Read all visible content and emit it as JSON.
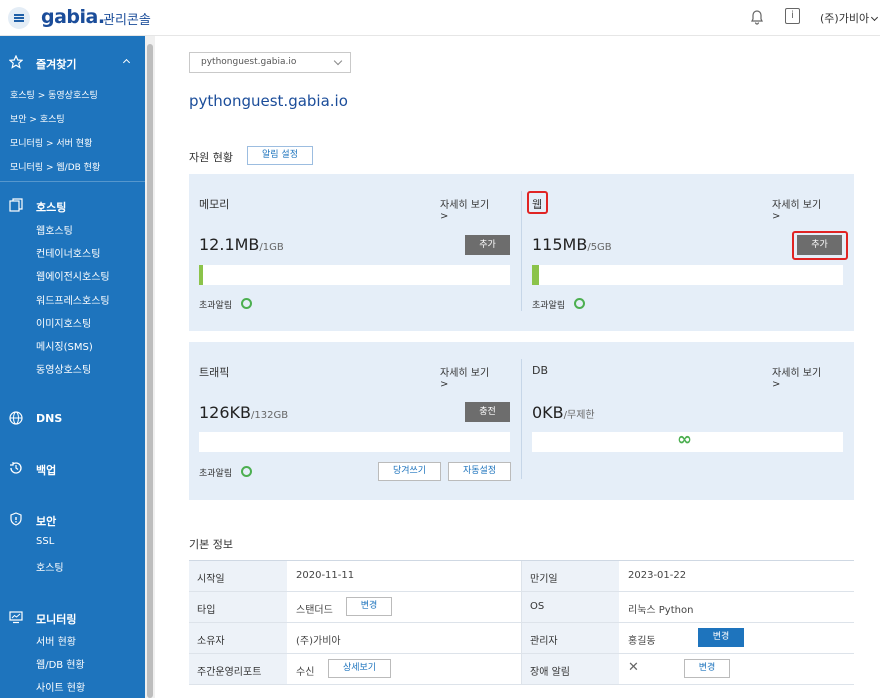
{
  "header": {
    "logo": "gabia.",
    "console_label": "관리콘솔",
    "user_menu": "(주)가비아",
    "info_glyph": "i",
    "icons": [
      "menu-icon",
      "bell-icon",
      "info-icon",
      "chevron-down-icon"
    ]
  },
  "sidebar": {
    "favorites": {
      "title": "즐겨찾기",
      "items": [
        "호스팅 > 동영상호스팅",
        "보안 > 호스팅",
        "모니터링 > 서버 현황",
        "모니터링 > 웹/DB 현황"
      ]
    },
    "hosting": {
      "title": "호스팅",
      "items": [
        "웹호스팅",
        "컨테이너호스팅",
        "웹에이전시호스팅",
        "워드프레스호스팅",
        "이미지호스팅",
        "메시징(SMS)",
        "동영상호스팅"
      ]
    },
    "dns": {
      "title": "DNS"
    },
    "backup": {
      "title": "백업"
    },
    "security": {
      "title": "보안",
      "items": [
        "SSL",
        "호스팅"
      ]
    },
    "monitoring": {
      "title": "모니터링",
      "items": [
        "서버 현황",
        "웹/DB 현황",
        "사이트 현황"
      ]
    },
    "accent_color": "#1e74bd"
  },
  "main": {
    "domain_select": "pythonguest.gabia.io",
    "domain_title": "pythonguest.gabia.io",
    "resources": {
      "label": "자원 현황",
      "alert_settings_button": "알림 설정",
      "detail_link": "자세히 보기 >",
      "memory": {
        "title": "메모리",
        "value": "12.1MB",
        "unit": "/1GB",
        "usage_fraction": 0.012,
        "button": "추가",
        "alert_label": "초과알림"
      },
      "web": {
        "title": "웹",
        "value": "115MB",
        "unit": "/5GB",
        "usage_fraction": 0.023,
        "button": "추가",
        "alert_label": "초과알림"
      },
      "traffic": {
        "title": "트래픽",
        "value": "126KB",
        "unit": "/132GB",
        "usage_fraction": 0,
        "button": "충전",
        "alert_label": "초과알림",
        "pull_button": "당겨쓰기",
        "auto_button": "자동설정"
      },
      "db": {
        "title": "DB",
        "value": "0KB",
        "unit": "/무제한",
        "infinity_glyph": "∞"
      }
    },
    "basic_info": {
      "label": "기본 정보",
      "rows": [
        {
          "k1": "시작일",
          "v1": "2020-11-11",
          "k2": "만기일",
          "v2": "2023-01-22"
        },
        {
          "k1": "타입",
          "v1": "스탠더드",
          "btn1": "변경",
          "k2": "OS",
          "v2": "리눅스 Python"
        },
        {
          "k1": "소유자",
          "v1": "(주)가비아",
          "k2": "관리자",
          "v2": "홍길동",
          "btn2": "변경"
        },
        {
          "k1": "주간운영리포트",
          "v1": "수신",
          "btn1": "상세보기",
          "k2": "장애 알림",
          "v2": "✕",
          "btn2": "변경"
        }
      ]
    }
  }
}
